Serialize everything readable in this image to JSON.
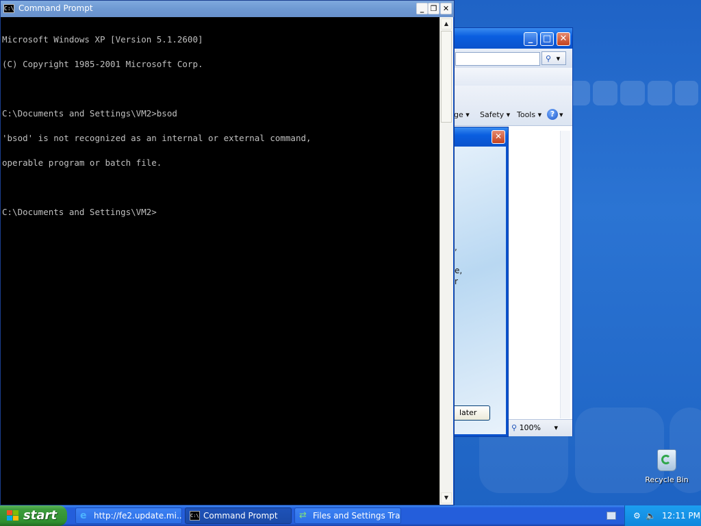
{
  "cmd": {
    "title": "Command Prompt",
    "lines": [
      "Microsoft Windows XP [Version 5.1.2600]",
      "(C) Copyright 1985-2001 Microsoft Corp.",
      "",
      "C:\\Documents and Settings\\VM2>bsod",
      "'bsod' is not recognized as an internal or external command,",
      "operable program or batch file.",
      "",
      "C:\\Documents and Settings\\VM2>"
    ],
    "btn_minimize": "_",
    "btn_restore": "❐",
    "btn_close": "✕"
  },
  "ie": {
    "menu": [
      "ge ▾",
      "Safety ▾",
      "Tools ▾"
    ],
    "help_label": "?",
    "zoom_level": "100%",
    "search_icon": "search-icon"
  },
  "fs_dialog": {
    "close": "✕",
    "fragments": [
      ",",
      "e,",
      "r"
    ],
    "later_button": "later"
  },
  "desktop": {
    "recycle_bin": "Recycle Bin"
  },
  "taskbar": {
    "start_label": "start",
    "tasks": [
      {
        "label": "http://fe2.update.mi...",
        "icon": "ie-icon"
      },
      {
        "label": "Command Prompt",
        "icon": "cmd-icon"
      },
      {
        "label": "Files and Settings Tra...",
        "icon": "migration-icon"
      }
    ],
    "clock": "12:11 PM"
  },
  "colors": {
    "xp_blue": "#245edb",
    "start_green": "#3c9c3c",
    "console_text": "#c0c0c0"
  }
}
